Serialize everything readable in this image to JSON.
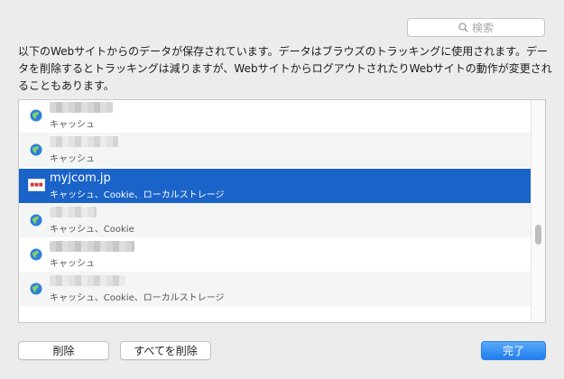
{
  "search": {
    "placeholder": "検索",
    "icon": "search-icon"
  },
  "description": "以下のWebサイトからのデータが保存されています。データはブラウズのトラッキングに使用されます。データを削除するとトラッキングは減りますが、WebサイトからログアウトされたりWebサイトの動作が変更されることもあります。",
  "sites": [
    {
      "name": "",
      "detail": "キャッシュ",
      "selected": false,
      "icon": "globe-icon"
    },
    {
      "name": "",
      "detail": "キャッシュ",
      "selected": false,
      "icon": "globe-icon"
    },
    {
      "name": "myjcom.jp",
      "detail": "キャッシュ、Cookie、ローカルストレージ",
      "selected": true,
      "icon": "site-favicon"
    },
    {
      "name": "",
      "detail": "キャッシュ、Cookie",
      "selected": false,
      "icon": "globe-icon"
    },
    {
      "name": "",
      "detail": "キャッシュ",
      "selected": false,
      "icon": "globe-icon"
    },
    {
      "name": "",
      "detail": "キャッシュ、Cookie、ローカルストレージ",
      "selected": false,
      "icon": "globe-icon"
    }
  ],
  "buttons": {
    "remove": "削除",
    "remove_all": "すべてを削除",
    "done": "完了"
  },
  "colors": {
    "selection": "#1a63c9",
    "primary": "#1f7ef0"
  }
}
